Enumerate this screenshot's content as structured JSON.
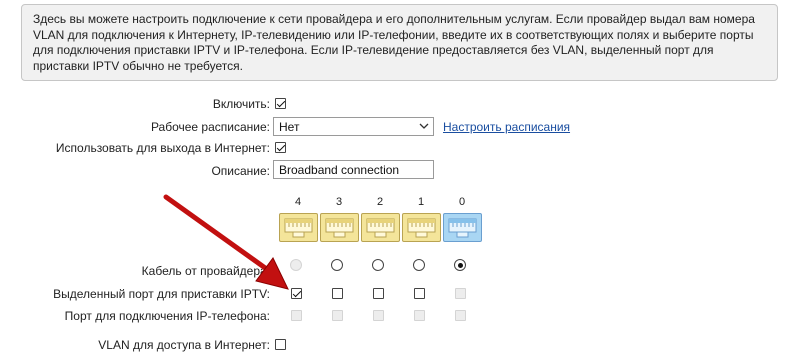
{
  "info": {
    "text": "Здесь вы можете настроить подключение к сети провайдера и его дополнительным услугам. Если провайдер выдал вам номера VLAN для подключения к Интернету, IP-телевидению или IP-телефонии, введите их в соответствующих полях и выберите порты для подключения приставки IPTV и IP-телефона. Если IP-телевидение предоставляется без VLAN, выделенный порт для приставки IPTV обычно не требуется."
  },
  "form": {
    "enable_label": "Включить:",
    "enable_checked": true,
    "schedule_label": "Рабочее расписание:",
    "schedule_value": "Нет",
    "schedule_link": "Настроить расписания",
    "internet_label": "Использовать для выхода в Интернет:",
    "internet_checked": true,
    "description_label": "Описание:",
    "description_value": "Broadband connection"
  },
  "ports": {
    "numbers": [
      "4",
      "3",
      "2",
      "1",
      "0"
    ],
    "wan_port": "0",
    "rows": {
      "cable_label": "Кабель от провайдера:",
      "iptv_label": "Выделенный порт для приставки IPTV:",
      "phone_label": "Порт для подключения IP-телефона:",
      "vlan_label": "VLAN для доступа в Интернет:"
    }
  },
  "colors": {
    "lan_port": "#f4e59a",
    "wan_port": "#a9d6f3",
    "arrow": "#c21010",
    "link": "#1a4ea0"
  },
  "icons": {
    "dropdown": "chevron-down-icon",
    "port": "ethernet-port-icon",
    "arrow": "red-arrow-annotation"
  }
}
